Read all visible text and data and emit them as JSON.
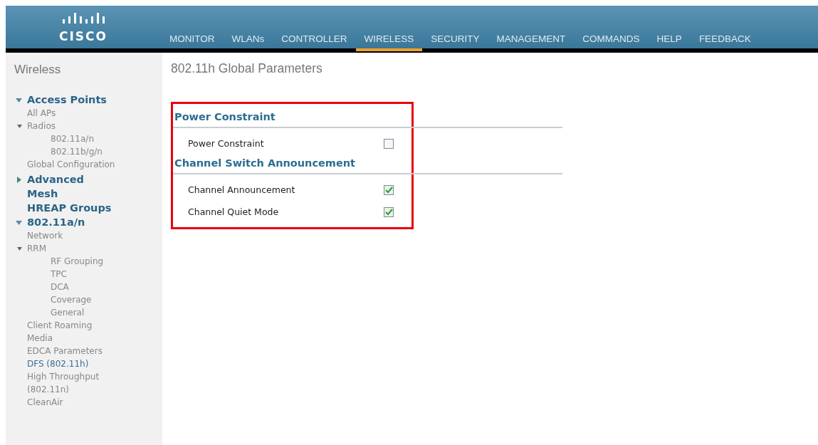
{
  "logo": {
    "wordmark": "CISCO"
  },
  "nav": [
    {
      "label": "MONITOR",
      "selected": false
    },
    {
      "label": "WLANs",
      "selected": false
    },
    {
      "label": "CONTROLLER",
      "selected": false
    },
    {
      "label": "WIRELESS",
      "selected": true
    },
    {
      "label": "SECURITY",
      "selected": false
    },
    {
      "label": "MANAGEMENT",
      "selected": false
    },
    {
      "label": "COMMANDS",
      "selected": false
    },
    {
      "label": "HELP",
      "selected": false
    },
    {
      "label": "FEEDBACK",
      "selected": false
    }
  ],
  "sidebar": {
    "title": "Wireless",
    "sections": [
      {
        "label": "Access Points",
        "kind": "group",
        "expanded": true,
        "children": [
          {
            "label": "All APs",
            "selected": false
          },
          {
            "label": "Radios",
            "selected": false,
            "children": [
              {
                "label": "802.11a/n",
                "selected": false
              },
              {
                "label": "802.11b/g/n",
                "selected": false
              }
            ]
          },
          {
            "label": "Global Configuration",
            "selected": false
          }
        ]
      },
      {
        "label": "Advanced",
        "kind": "group",
        "expanded": false
      },
      {
        "label": "Mesh",
        "kind": "link"
      },
      {
        "label": "HREAP Groups",
        "kind": "link"
      },
      {
        "label": "802.11a/n",
        "kind": "group",
        "expanded": true,
        "children": [
          {
            "label": "Network",
            "selected": false
          },
          {
            "label": "RRM",
            "selected": false,
            "children": [
              {
                "label": "RF Grouping",
                "selected": false
              },
              {
                "label": "TPC",
                "selected": false
              },
              {
                "label": "DCA",
                "selected": false
              },
              {
                "label": "Coverage",
                "selected": false
              },
              {
                "label": "General",
                "selected": false
              }
            ]
          },
          {
            "label": "Client Roaming",
            "selected": false
          },
          {
            "label": "Media",
            "selected": false
          },
          {
            "label": "EDCA Parameters",
            "selected": false
          },
          {
            "label": "DFS (802.11h)",
            "selected": true
          },
          {
            "label": "High Throughput (802.11n)",
            "selected": false
          },
          {
            "label": "CleanAir",
            "selected": false
          }
        ]
      }
    ]
  },
  "page": {
    "title": "802.11h Global Parameters",
    "sections": [
      {
        "heading": "Power Constraint",
        "rows": [
          {
            "label": "Power Constraint",
            "checked": false
          }
        ]
      },
      {
        "heading": "Channel Switch Announcement",
        "rows": [
          {
            "label": "Channel Announcement",
            "checked": true
          },
          {
            "label": "Channel Quiet Mode",
            "checked": true
          }
        ]
      }
    ]
  }
}
